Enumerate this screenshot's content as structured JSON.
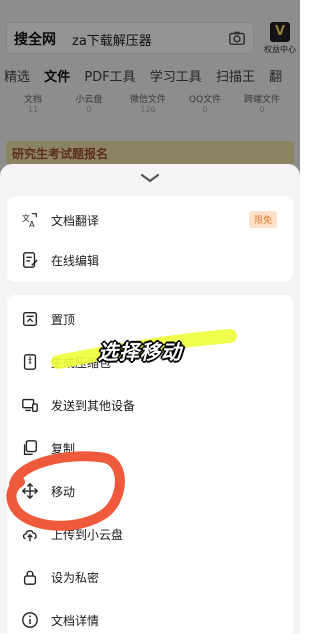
{
  "search": {
    "prefix": "搜全网",
    "query": "za下载解压器"
  },
  "vip": {
    "badge": "V",
    "label": "权益中心"
  },
  "tabs": [
    "精选",
    "文件",
    "PDF工具",
    "学习工具",
    "扫描王",
    "翻"
  ],
  "stats": [
    {
      "label": "文档",
      "value": "11"
    },
    {
      "label": "小云盘",
      "value": "0"
    },
    {
      "label": "微信文件",
      "value": "126"
    },
    {
      "label": "QQ文件",
      "value": "0"
    },
    {
      "label": "跨端文件",
      "value": "0"
    }
  ],
  "banner": {
    "text": "研究生考试题报名"
  },
  "sheet": {
    "group1": [
      {
        "label": "文档翻译",
        "icon": "translate-icon",
        "tag": "限免"
      },
      {
        "label": "在线编辑",
        "icon": "edit-doc-icon"
      }
    ],
    "group2": [
      {
        "label": "置顶",
        "icon": "pin-top-icon"
      },
      {
        "label": "生成压缩包",
        "icon": "zip-icon"
      },
      {
        "label": "发送到其他设备",
        "icon": "send-device-icon"
      },
      {
        "label": "复制",
        "icon": "copy-icon"
      },
      {
        "label": "移动",
        "icon": "move-icon"
      },
      {
        "label": "上传到小云盘",
        "icon": "cloud-upload-icon"
      },
      {
        "label": "设为私密",
        "icon": "lock-icon"
      },
      {
        "label": "文档详情",
        "icon": "info-icon"
      }
    ]
  },
  "annotation": {
    "text": "选择移动",
    "highlight_color": "#f0ff3a",
    "circle_color": "#f05a3c"
  },
  "colors": {
    "tag_bg": "#ffe1c9",
    "tag_fg": "#e07a30",
    "vip_gold": "#f2cf63"
  }
}
